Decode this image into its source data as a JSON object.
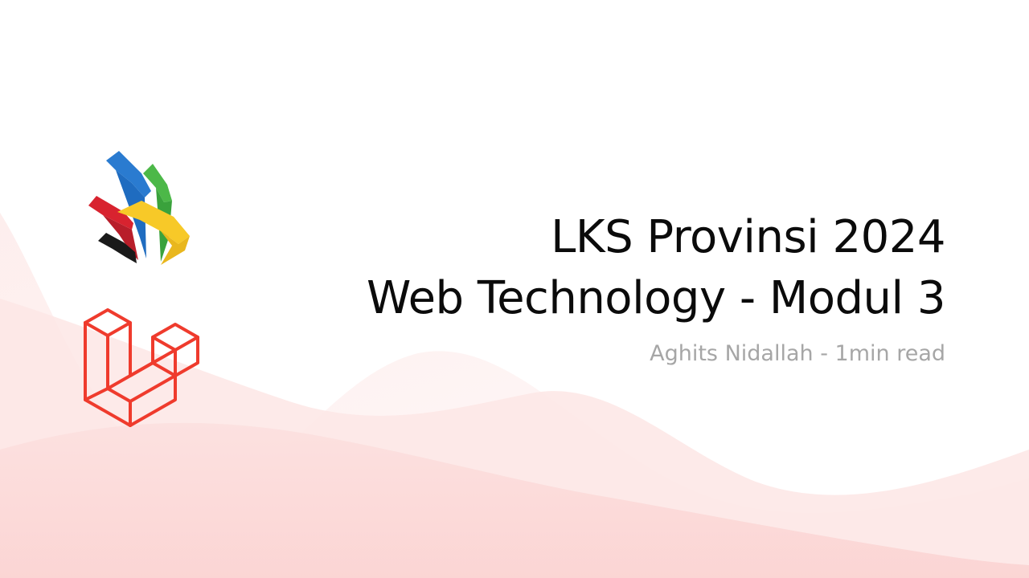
{
  "title": {
    "line1": "LKS Provinsi 2024",
    "line2": "Web Technology - Modul 3"
  },
  "meta": {
    "text": "Aghits Nidallah - 1min read"
  },
  "icons": {
    "competition_logo": "lks-logo-icon",
    "framework_logo": "laravel-logo-icon"
  },
  "colors": {
    "background": "#ffffff",
    "wave_light": "#fdeaea",
    "wave_mid": "#fcd9d8",
    "laravel_red": "#ef3b2d",
    "title": "#0b0b0b",
    "meta": "#a6a6a6",
    "lks_blue": "#2a7bd0",
    "lks_green": "#4cb848",
    "lks_red": "#d8232f",
    "lks_yellow": "#f7c928",
    "lks_black": "#1a1a1a"
  }
}
